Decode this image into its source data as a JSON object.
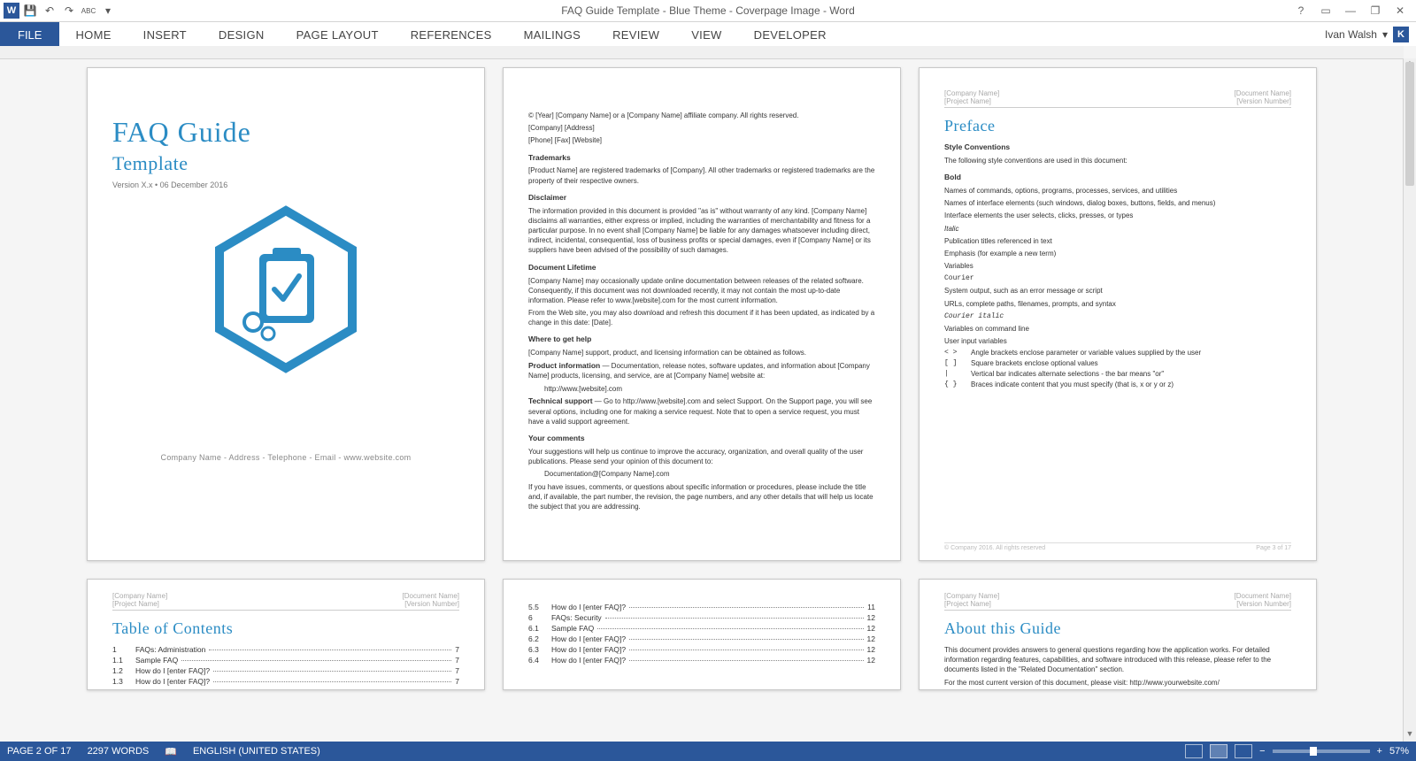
{
  "titlebar": {
    "doc_title": "FAQ Guide Template - Blue Theme - Coverpage Image - Word"
  },
  "qat": {
    "word": "W",
    "save": "💾",
    "undo": "↶",
    "redo": "↷",
    "spell": "ABC",
    "more": "▾"
  },
  "wincontrols": {
    "help": "?",
    "ribbon": "▭",
    "min": "—",
    "max": "❐",
    "close": "✕"
  },
  "ribbon": {
    "file": "FILE",
    "tabs": [
      "HOME",
      "INSERT",
      "DESIGN",
      "PAGE LAYOUT",
      "REFERENCES",
      "MAILINGS",
      "REVIEW",
      "VIEW",
      "DEVELOPER"
    ],
    "user": "Ivan Walsh",
    "user_initial": "K",
    "user_caret": "▾"
  },
  "page1": {
    "title": "FAQ Guide",
    "subtitle": "Template",
    "version": "Version X.x • 06 December 2016",
    "company_line": "Company Name - Address - Telephone - Email - www.website.com"
  },
  "page2": {
    "copyright": "© [Year] [Company Name] or a [Company Name] affiliate company. All rights reserved.",
    "addr": "[Company] [Address]",
    "contact": "[Phone] [Fax] [Website]",
    "h_trademarks": "Trademarks",
    "p_trademarks": "[Product Name] are registered trademarks of [Company]. All other trademarks or registered trademarks are the property of their respective owners.",
    "h_disclaimer": "Disclaimer",
    "p_disclaimer": "The information provided in this document is provided \"as is\" without warranty of any kind. [Company Name] disclaims all warranties, either express or implied, including the warranties of merchantability and fitness for a particular purpose. In no event shall [Company Name] be liable for any damages whatsoever including direct, indirect, incidental, consequential, loss of business profits or special damages, even if [Company Name] or its suppliers have been advised of the possibility of such damages.",
    "h_lifetime": "Document Lifetime",
    "p_lifetime1": "[Company Name] may occasionally update online documentation between releases of the related software. Consequently, if this document was not downloaded recently, it may not contain the most up-to-date information. Please refer to www.[website].com for the most current information.",
    "p_lifetime2": "From the Web site, you may also download and refresh this document if it has been updated, as indicated by a change in this date: [Date].",
    "h_help": "Where to get help",
    "p_help": "[Company Name] support, product, and licensing information can be obtained as follows.",
    "h_prodinfo": "Product information",
    "p_prodinfo": " — Documentation, release notes, software updates, and information about [Company Name] products, licensing, and service, are at [Company Name] website at:",
    "url1": "http://www.[website].com",
    "h_tech": "Technical support",
    "p_tech": " — Go to http://www.[website].com and select Support. On the Support page, you will see several options, including one for making a service request. Note that to open a service request, you must have a valid support agreement.",
    "h_comments": "Your comments",
    "p_comments1": "Your suggestions will help us continue to improve the accuracy, organization, and overall quality of the user publications. Please send your opinion of this document to:",
    "email": "Documentation@[Company Name].com",
    "p_comments2": "If you have issues, comments, or questions about specific information or procedures, please include the title and, if available, the part number, the revision, the page numbers, and any other details that will help us locate the subject that you are addressing."
  },
  "page3": {
    "hdr_l1": "[Company Name]",
    "hdr_l2": "[Project Name]",
    "hdr_r1": "[Document Name]",
    "hdr_r2": "[Version Number]",
    "preface": "Preface",
    "h_style": "Style Conventions",
    "p_intro": "The following style conventions are used in this document:",
    "l_bold": "Bold",
    "l_bold1": "Names of commands, options, programs, processes, services, and utilities",
    "l_bold2": "Names of interface elements (such windows, dialog boxes, buttons, fields, and menus)",
    "l_bold3": "Interface elements the user selects, clicks, presses, or types",
    "l_italic": "Italic",
    "l_italic1": "Publication titles referenced in text",
    "l_italic2": "Emphasis (for example a new term)",
    "l_italic3": "Variables",
    "l_courier": "Courier",
    "l_courier1": "System output, such as an error message or script",
    "l_courier2": "URLs, complete paths, filenames, prompts, and syntax",
    "l_ci": "Courier italic",
    "l_ci1": "Variables on command line",
    "l_ci2": "User input variables",
    "sym": [
      {
        "s": "< >",
        "d": "Angle brackets enclose parameter or variable values supplied by the user"
      },
      {
        "s": "[ ]",
        "d": "Square brackets enclose optional values"
      },
      {
        "s": "|",
        "d": "Vertical bar indicates alternate selections - the bar means \"or\""
      },
      {
        "s": "{ }",
        "d": "Braces indicate content that you must specify (that is, x or y or z)"
      }
    ],
    "ftr_l": "© Company 2016. All rights reserved",
    "ftr_r": "Page 3 of 17"
  },
  "page4": {
    "hdr_l1": "[Company Name]",
    "hdr_l2": "[Project Name]",
    "hdr_r1": "[Document Name]",
    "hdr_r2": "[Version Number]",
    "title": "Table of Contents",
    "rows": [
      {
        "n": "1",
        "t": "FAQs: Administration",
        "p": "7"
      },
      {
        "n": "1.1",
        "t": "Sample FAQ",
        "p": "7"
      },
      {
        "n": "1.2",
        "t": "How do I [enter FAQ]?",
        "p": "7"
      },
      {
        "n": "1.3",
        "t": "How do I [enter FAQ]?",
        "p": "7"
      }
    ]
  },
  "page5": {
    "rows": [
      {
        "n": "5.5",
        "t": "How do I [enter FAQ]?",
        "p": "11"
      },
      {
        "n": "6",
        "t": "FAQs: Security",
        "p": "12"
      },
      {
        "n": "6.1",
        "t": "Sample FAQ",
        "p": "12"
      },
      {
        "n": "6.2",
        "t": "How do I [enter FAQ]?",
        "p": "12"
      },
      {
        "n": "6.3",
        "t": "How do I [enter FAQ]?",
        "p": "12"
      },
      {
        "n": "6.4",
        "t": "How do I [enter FAQ]?",
        "p": "12"
      }
    ]
  },
  "page6": {
    "hdr_l1": "[Company Name]",
    "hdr_l2": "[Project Name]",
    "hdr_r1": "[Document Name]",
    "hdr_r2": "[Version Number]",
    "title": "About this Guide",
    "p1": "This document provides answers to general questions regarding how the application works. For detailed information regarding features, capabilities, and software introduced with this release, please refer to the documents listed in the \"Related Documentation\" section.",
    "p2": "For the most current version of this document, please visit: http://www.yourwebsite.com/"
  },
  "status": {
    "page": "PAGE 2 OF 17",
    "words": "2297 WORDS",
    "lang": "ENGLISH (UNITED STATES)",
    "zoom": "57%",
    "minus": "−",
    "plus": "+"
  }
}
